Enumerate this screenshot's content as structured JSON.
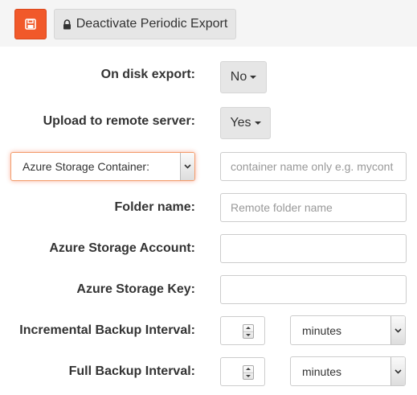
{
  "toolbar": {
    "save_icon": "floppy-disk-icon",
    "deactivate_label": "Deactivate Periodic Export",
    "deactivate_icon": "lock-icon",
    "accent_color": "#f1592a"
  },
  "form": {
    "on_disk_export": {
      "label": "On disk export:",
      "value": "No"
    },
    "upload_remote": {
      "label": "Upload to remote server:",
      "value": "Yes"
    },
    "storage_type": {
      "selected": "Azure Storage Container:",
      "container_placeholder": "container name only e.g. mycont"
    },
    "folder_name": {
      "label": "Folder name:",
      "placeholder": "Remote folder name"
    },
    "azure_account": {
      "label": "Azure Storage Account:",
      "value": ""
    },
    "azure_key": {
      "label": "Azure Storage Key:",
      "value": ""
    },
    "incremental_interval": {
      "label": "Incremental Backup Interval:",
      "unit": "minutes"
    },
    "full_interval": {
      "label": "Full Backup Interval:",
      "unit": "minutes"
    }
  }
}
